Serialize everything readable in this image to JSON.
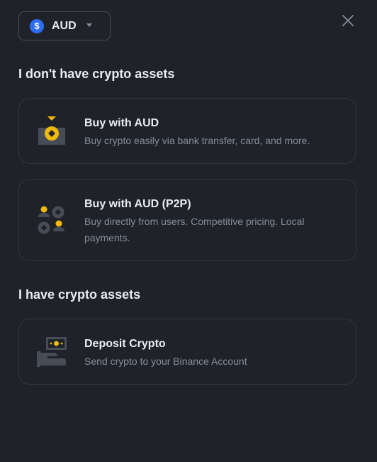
{
  "currency": {
    "code": "AUD",
    "symbol": "$",
    "icon_color": "#2d6df6"
  },
  "sections": {
    "no_crypto_title": "I don't have crypto assets",
    "have_crypto_title": "I have crypto assets"
  },
  "options": {
    "buy": {
      "title": "Buy with AUD",
      "description": "Buy crypto easily via bank transfer, card, and more."
    },
    "p2p": {
      "title": "Buy with AUD (P2P)",
      "description": "Buy directly from users. Competitive pricing. Local payments."
    },
    "deposit": {
      "title": "Deposit Crypto",
      "description": "Send crypto to your Binance Account"
    }
  },
  "colors": {
    "accent": "#f0b90b",
    "background": "#1f2329",
    "muted_text": "#848e9c"
  },
  "icons": [
    "dollar-icon",
    "caret-down-icon",
    "close-icon",
    "buy-fiat-icon",
    "p2p-icon",
    "deposit-icon"
  ]
}
